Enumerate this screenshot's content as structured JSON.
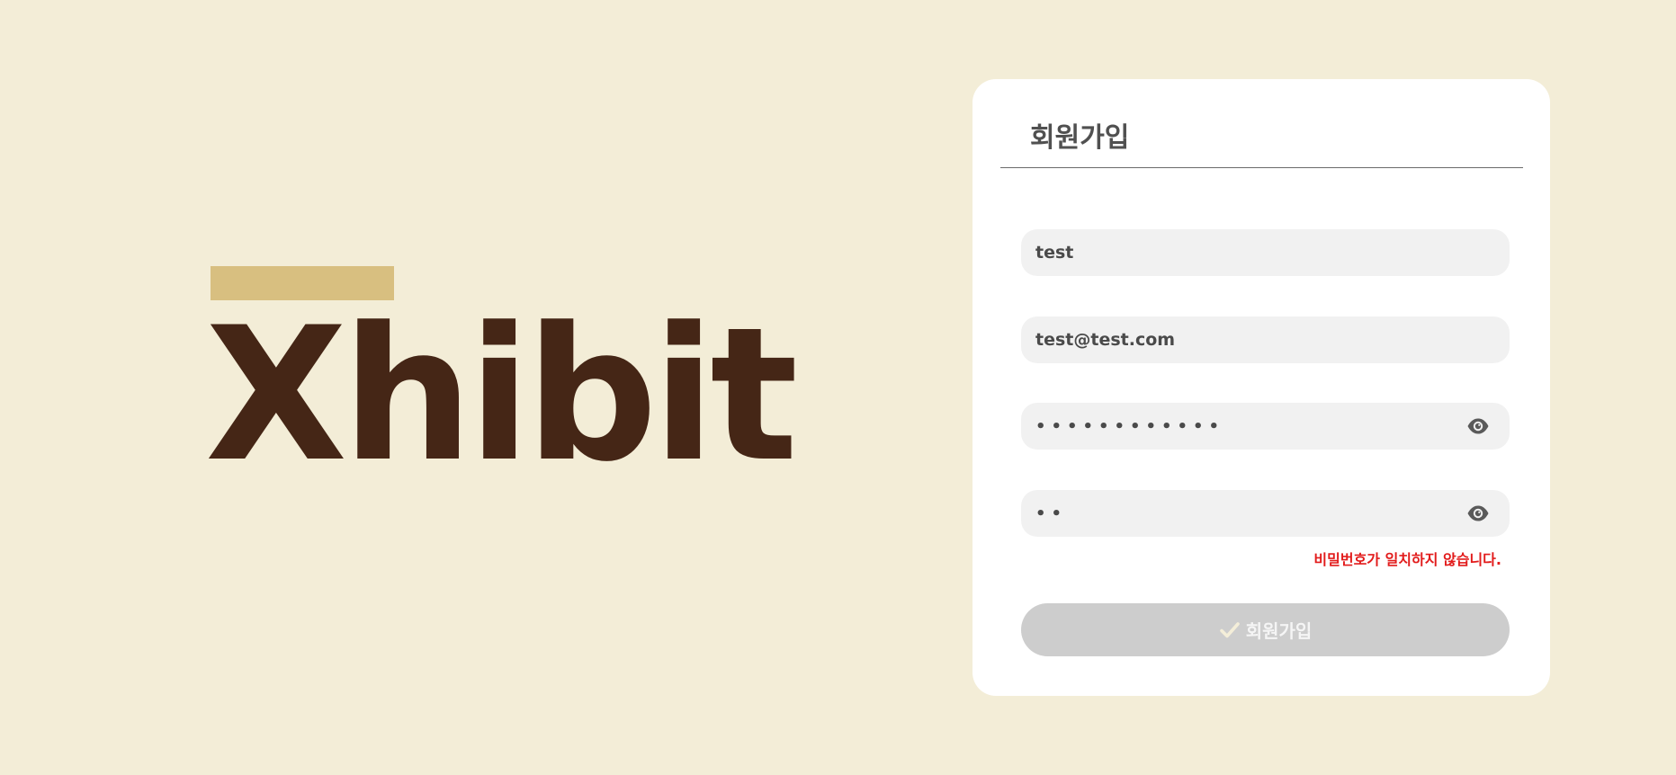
{
  "brand": {
    "logo_text": "Xhibit",
    "bar_color": "#d8bf80",
    "logo_color": "#452616"
  },
  "signup": {
    "title": "회원가입",
    "username": {
      "value": "test"
    },
    "email": {
      "value": "test@test.com"
    },
    "password": {
      "value": "••••••••••••",
      "toggle_icon": "eye-icon"
    },
    "password_confirm": {
      "value": "••",
      "toggle_icon": "eye-icon"
    },
    "error_message": "비밀번호가 일치하지 않습니다.",
    "submit": {
      "icon": "check-icon",
      "label": "회원가입",
      "disabled": true
    }
  },
  "colors": {
    "background": "#f3edd7",
    "card": "#ffffff",
    "field": "#f1f1f1",
    "error": "#e21b1b",
    "button_disabled": "#cdcdcd"
  }
}
